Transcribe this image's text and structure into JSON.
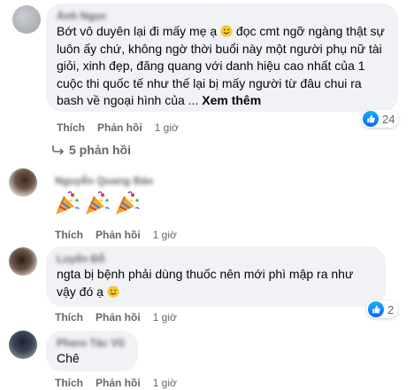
{
  "comments": [
    {
      "author": "Ánh Ngọc",
      "text": "Bớt vô duyên lại đi mấy mẹ ạ",
      "text_after_emoji": " đọc cmt ngỡ ngàng thật sự luôn ấy chứ, không ngờ thời buổi này một người phụ nữ tài giỏi, xinh đẹp, đăng quang với danh hiệu cao nhất của 1 cuộc thi quốc tế như thế lại bị mấy người từ đâu chui ra bash về ngoại hình của ...",
      "see_more": "Xem thêm",
      "reaction_count": "24",
      "reaction_icon": "like-icon",
      "like_label": "Thích",
      "reply_label": "Phản hồi",
      "time": "1 giờ",
      "replies_link": "5 phản hồi"
    },
    {
      "author": "Nguyễn Quang Bảo",
      "emoji_content": [
        "party-popper",
        "party-popper",
        "party-popper"
      ],
      "like_label": "Thích",
      "reply_label": "Phản hồi",
      "time": "1 giờ"
    },
    {
      "author": "Luyến Đỗ",
      "text": "ngta bị bệnh phải dùng thuốc nên mới phì mập ra như vậy đó ạ",
      "reaction_count": "2",
      "reaction_icon": "like-icon",
      "like_label": "Thích",
      "reply_label": "Phản hồi",
      "time": "1 giờ"
    },
    {
      "author": "Phero Tác Vũ",
      "text": "Chê",
      "like_label": "Thích",
      "reply_label": "Phản hồi",
      "time": "1 giờ"
    }
  ],
  "colors": {
    "bubble": "#f0f2f5",
    "secondary_text": "#65676b",
    "like_blue": "#0866ff"
  }
}
